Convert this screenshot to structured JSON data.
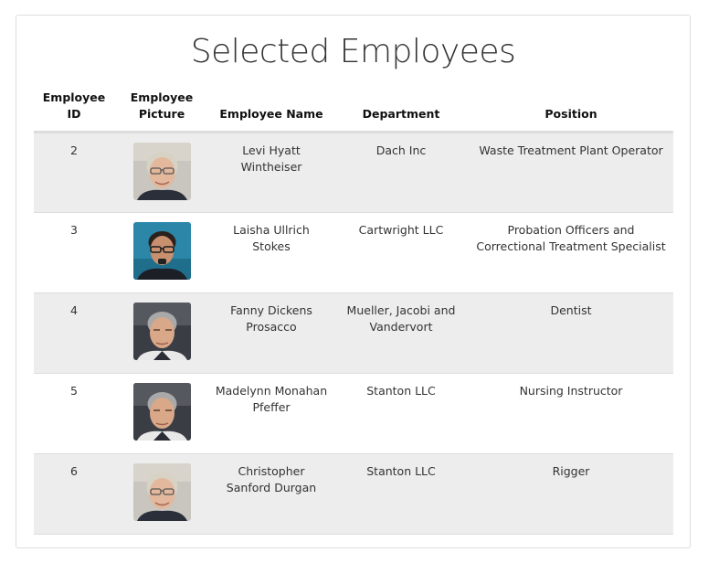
{
  "page": {
    "title": "Selected Employees"
  },
  "table": {
    "headers": {
      "id": "Employee ID",
      "picture": "Employee Picture",
      "name": "Employee Name",
      "department": "Department",
      "position": "Position"
    },
    "rows": [
      {
        "id": "2",
        "name": "Levi Hyatt Wintheiser",
        "department": "Dach Inc",
        "position": "Waste Treatment Plant Operator",
        "picture": "portrait-grey-hair-glasses"
      },
      {
        "id": "3",
        "name": "Laisha Ullrich Stokes",
        "department": "Cartwright LLC",
        "position": "Probation Officers and Correctional Treatment Specialist",
        "picture": "portrait-dark-hair-glasses-blue-background"
      },
      {
        "id": "4",
        "name": "Fanny Dickens Prosacco",
        "department": "Mueller, Jacobi and Vandervort",
        "position": "Dentist",
        "picture": "portrait-grey-hair-dark-background"
      },
      {
        "id": "5",
        "name": "Madelynn Monahan Pfeffer",
        "department": "Stanton LLC",
        "position": "Nursing Instructor",
        "picture": "portrait-grey-hair-dark-background"
      },
      {
        "id": "6",
        "name": "Christopher Sanford Durgan",
        "department": "Stanton LLC",
        "position": "Rigger",
        "picture": "portrait-grey-hair-glasses"
      }
    ]
  }
}
